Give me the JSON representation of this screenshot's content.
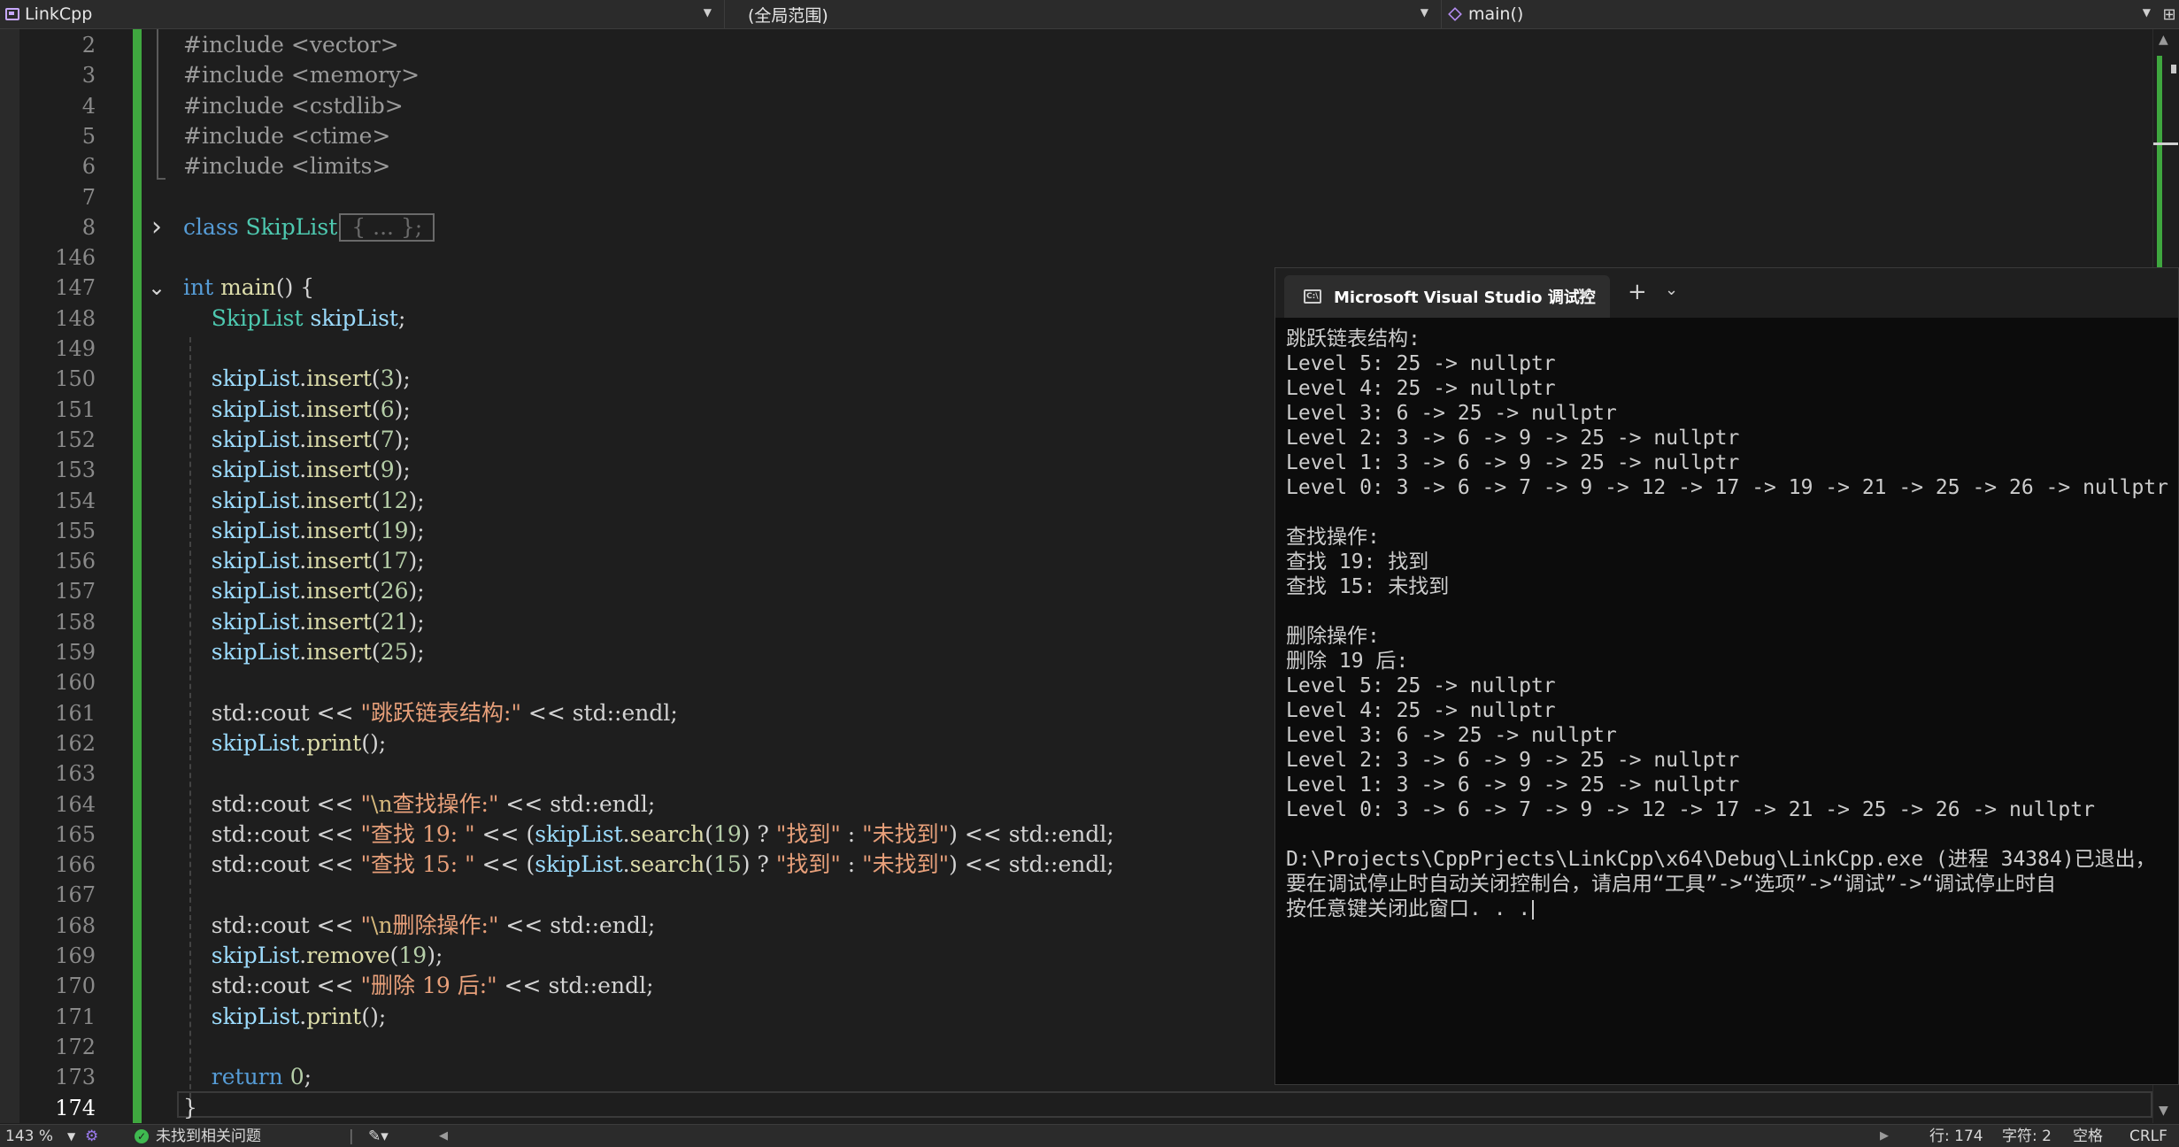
{
  "navbar": {
    "project": "LinkCpp",
    "scope": "(全局范围)",
    "function": "main()",
    "split_icon": "split-icon"
  },
  "editor": {
    "lines": [
      {
        "num": "2",
        "tokens": [
          {
            "t": "#include <vector>",
            "c": "pre"
          }
        ]
      },
      {
        "num": "3",
        "tokens": [
          {
            "t": "#include <memory>",
            "c": "pre"
          }
        ]
      },
      {
        "num": "4",
        "tokens": [
          {
            "t": "#include <cstdlib>",
            "c": "pre"
          }
        ]
      },
      {
        "num": "5",
        "tokens": [
          {
            "t": "#include <ctime>",
            "c": "pre"
          }
        ]
      },
      {
        "num": "6",
        "tokens": [
          {
            "t": "#include <limits>",
            "c": "pre"
          }
        ]
      },
      {
        "num": "7",
        "tokens": []
      },
      {
        "num": "8",
        "fold": "collapsed",
        "tokens": [
          {
            "t": "class ",
            "c": "kw"
          },
          {
            "t": "SkipList",
            "c": "type"
          }
        ],
        "collapsed": "{ ... };"
      },
      {
        "num": "146",
        "tokens": []
      },
      {
        "num": "147",
        "fold": "expanded",
        "tokens": [
          {
            "t": "int ",
            "c": "kw"
          },
          {
            "t": "main",
            "c": "fn"
          },
          {
            "t": "() {",
            "c": "op"
          }
        ]
      },
      {
        "num": "148",
        "tokens": [
          {
            "t": "    ",
            "c": "plain"
          },
          {
            "t": "SkipList ",
            "c": "type"
          },
          {
            "t": "skipList",
            "c": "var"
          },
          {
            "t": ";",
            "c": "op"
          }
        ]
      },
      {
        "num": "149",
        "tokens": []
      },
      {
        "num": "150",
        "tokens": [
          {
            "t": "    ",
            "c": "plain"
          },
          {
            "t": "skipList",
            "c": "var"
          },
          {
            "t": ".",
            "c": "op"
          },
          {
            "t": "insert",
            "c": "fn"
          },
          {
            "t": "(",
            "c": "op"
          },
          {
            "t": "3",
            "c": "num"
          },
          {
            "t": ");",
            "c": "op"
          }
        ]
      },
      {
        "num": "151",
        "tokens": [
          {
            "t": "    ",
            "c": "plain"
          },
          {
            "t": "skipList",
            "c": "var"
          },
          {
            "t": ".",
            "c": "op"
          },
          {
            "t": "insert",
            "c": "fn"
          },
          {
            "t": "(",
            "c": "op"
          },
          {
            "t": "6",
            "c": "num"
          },
          {
            "t": ");",
            "c": "op"
          }
        ]
      },
      {
        "num": "152",
        "tokens": [
          {
            "t": "    ",
            "c": "plain"
          },
          {
            "t": "skipList",
            "c": "var"
          },
          {
            "t": ".",
            "c": "op"
          },
          {
            "t": "insert",
            "c": "fn"
          },
          {
            "t": "(",
            "c": "op"
          },
          {
            "t": "7",
            "c": "num"
          },
          {
            "t": ");",
            "c": "op"
          }
        ]
      },
      {
        "num": "153",
        "tokens": [
          {
            "t": "    ",
            "c": "plain"
          },
          {
            "t": "skipList",
            "c": "var"
          },
          {
            "t": ".",
            "c": "op"
          },
          {
            "t": "insert",
            "c": "fn"
          },
          {
            "t": "(",
            "c": "op"
          },
          {
            "t": "9",
            "c": "num"
          },
          {
            "t": ");",
            "c": "op"
          }
        ]
      },
      {
        "num": "154",
        "tokens": [
          {
            "t": "    ",
            "c": "plain"
          },
          {
            "t": "skipList",
            "c": "var"
          },
          {
            "t": ".",
            "c": "op"
          },
          {
            "t": "insert",
            "c": "fn"
          },
          {
            "t": "(",
            "c": "op"
          },
          {
            "t": "12",
            "c": "num"
          },
          {
            "t": ");",
            "c": "op"
          }
        ]
      },
      {
        "num": "155",
        "tokens": [
          {
            "t": "    ",
            "c": "plain"
          },
          {
            "t": "skipList",
            "c": "var"
          },
          {
            "t": ".",
            "c": "op"
          },
          {
            "t": "insert",
            "c": "fn"
          },
          {
            "t": "(",
            "c": "op"
          },
          {
            "t": "19",
            "c": "num"
          },
          {
            "t": ");",
            "c": "op"
          }
        ]
      },
      {
        "num": "156",
        "tokens": [
          {
            "t": "    ",
            "c": "plain"
          },
          {
            "t": "skipList",
            "c": "var"
          },
          {
            "t": ".",
            "c": "op"
          },
          {
            "t": "insert",
            "c": "fn"
          },
          {
            "t": "(",
            "c": "op"
          },
          {
            "t": "17",
            "c": "num"
          },
          {
            "t": ");",
            "c": "op"
          }
        ]
      },
      {
        "num": "157",
        "tokens": [
          {
            "t": "    ",
            "c": "plain"
          },
          {
            "t": "skipList",
            "c": "var"
          },
          {
            "t": ".",
            "c": "op"
          },
          {
            "t": "insert",
            "c": "fn"
          },
          {
            "t": "(",
            "c": "op"
          },
          {
            "t": "26",
            "c": "num"
          },
          {
            "t": ");",
            "c": "op"
          }
        ]
      },
      {
        "num": "158",
        "tokens": [
          {
            "t": "    ",
            "c": "plain"
          },
          {
            "t": "skipList",
            "c": "var"
          },
          {
            "t": ".",
            "c": "op"
          },
          {
            "t": "insert",
            "c": "fn"
          },
          {
            "t": "(",
            "c": "op"
          },
          {
            "t": "21",
            "c": "num"
          },
          {
            "t": ");",
            "c": "op"
          }
        ]
      },
      {
        "num": "159",
        "tokens": [
          {
            "t": "    ",
            "c": "plain"
          },
          {
            "t": "skipList",
            "c": "var"
          },
          {
            "t": ".",
            "c": "op"
          },
          {
            "t": "insert",
            "c": "fn"
          },
          {
            "t": "(",
            "c": "op"
          },
          {
            "t": "25",
            "c": "num"
          },
          {
            "t": ");",
            "c": "op"
          }
        ]
      },
      {
        "num": "160",
        "tokens": []
      },
      {
        "num": "161",
        "tokens": [
          {
            "t": "    std::cout << ",
            "c": "plain"
          },
          {
            "t": "\"跳跃链表结构:\"",
            "c": "str"
          },
          {
            "t": " << std::endl;",
            "c": "plain"
          }
        ]
      },
      {
        "num": "162",
        "tokens": [
          {
            "t": "    ",
            "c": "plain"
          },
          {
            "t": "skipList",
            "c": "var"
          },
          {
            "t": ".",
            "c": "op"
          },
          {
            "t": "print",
            "c": "fn"
          },
          {
            "t": "();",
            "c": "op"
          }
        ]
      },
      {
        "num": "163",
        "tokens": []
      },
      {
        "num": "164",
        "tokens": [
          {
            "t": "    std::cout << ",
            "c": "plain"
          },
          {
            "t": "\"",
            "c": "str"
          },
          {
            "t": "\\n",
            "c": "esc"
          },
          {
            "t": "查找操作:\"",
            "c": "str"
          },
          {
            "t": " << std::endl;",
            "c": "plain"
          }
        ]
      },
      {
        "num": "165",
        "tokens": [
          {
            "t": "    std::cout << ",
            "c": "plain"
          },
          {
            "t": "\"查找 19: \"",
            "c": "str"
          },
          {
            "t": " << (",
            "c": "plain"
          },
          {
            "t": "skipList",
            "c": "var"
          },
          {
            "t": ".",
            "c": "op"
          },
          {
            "t": "search",
            "c": "fn"
          },
          {
            "t": "(",
            "c": "op"
          },
          {
            "t": "19",
            "c": "num"
          },
          {
            "t": ") ? ",
            "c": "op"
          },
          {
            "t": "\"找到\"",
            "c": "str"
          },
          {
            "t": " : ",
            "c": "op"
          },
          {
            "t": "\"未找到\"",
            "c": "str"
          },
          {
            "t": ") << std::endl;",
            "c": "plain"
          }
        ]
      },
      {
        "num": "166",
        "tokens": [
          {
            "t": "    std::cout << ",
            "c": "plain"
          },
          {
            "t": "\"查找 15: \"",
            "c": "str"
          },
          {
            "t": " << (",
            "c": "plain"
          },
          {
            "t": "skipList",
            "c": "var"
          },
          {
            "t": ".",
            "c": "op"
          },
          {
            "t": "search",
            "c": "fn"
          },
          {
            "t": "(",
            "c": "op"
          },
          {
            "t": "15",
            "c": "num"
          },
          {
            "t": ") ? ",
            "c": "op"
          },
          {
            "t": "\"找到\"",
            "c": "str"
          },
          {
            "t": " : ",
            "c": "op"
          },
          {
            "t": "\"未找到\"",
            "c": "str"
          },
          {
            "t": ") << std::endl;",
            "c": "plain"
          }
        ]
      },
      {
        "num": "167",
        "tokens": []
      },
      {
        "num": "168",
        "tokens": [
          {
            "t": "    std::cout << ",
            "c": "plain"
          },
          {
            "t": "\"",
            "c": "str"
          },
          {
            "t": "\\n",
            "c": "esc"
          },
          {
            "t": "删除操作:\"",
            "c": "str"
          },
          {
            "t": " << std::endl;",
            "c": "plain"
          }
        ]
      },
      {
        "num": "169",
        "tokens": [
          {
            "t": "    ",
            "c": "plain"
          },
          {
            "t": "skipList",
            "c": "var"
          },
          {
            "t": ".",
            "c": "op"
          },
          {
            "t": "remove",
            "c": "fn"
          },
          {
            "t": "(",
            "c": "op"
          },
          {
            "t": "19",
            "c": "num"
          },
          {
            "t": ");",
            "c": "op"
          }
        ]
      },
      {
        "num": "170",
        "tokens": [
          {
            "t": "    std::cout << ",
            "c": "plain"
          },
          {
            "t": "\"删除 19 后:\"",
            "c": "str"
          },
          {
            "t": " << std::endl;",
            "c": "plain"
          }
        ]
      },
      {
        "num": "171",
        "tokens": [
          {
            "t": "    ",
            "c": "plain"
          },
          {
            "t": "skipList",
            "c": "var"
          },
          {
            "t": ".",
            "c": "op"
          },
          {
            "t": "print",
            "c": "fn"
          },
          {
            "t": "();",
            "c": "op"
          }
        ]
      },
      {
        "num": "172",
        "tokens": []
      },
      {
        "num": "173",
        "tokens": [
          {
            "t": "    ",
            "c": "plain"
          },
          {
            "t": "return ",
            "c": "kw"
          },
          {
            "t": "0",
            "c": "num"
          },
          {
            "t": ";",
            "c": "op"
          }
        ]
      },
      {
        "num": "174",
        "current": true,
        "tokens": [
          {
            "t": "}",
            "c": "plain"
          }
        ]
      }
    ]
  },
  "terminal": {
    "tab_title": "Microsoft Visual Studio 调试控",
    "tab_icon": "console-icon",
    "new_tab_label": "+",
    "dropdown_icon": "chevron-down-icon",
    "lines": [
      "跳跃链表结构:",
      "Level 5: 25 -> nullptr",
      "Level 4: 25 -> nullptr",
      "Level 3: 6 -> 25 -> nullptr",
      "Level 2: 3 -> 6 -> 9 -> 25 -> nullptr",
      "Level 1: 3 -> 6 -> 9 -> 25 -> nullptr",
      "Level 0: 3 -> 6 -> 7 -> 9 -> 12 -> 17 -> 19 -> 21 -> 25 -> 26 -> nullptr",
      "",
      "查找操作:",
      "查找 19: 找到",
      "查找 15: 未找到",
      "",
      "删除操作:",
      "删除 19 后:",
      "Level 5: 25 -> nullptr",
      "Level 4: 25 -> nullptr",
      "Level 3: 6 -> 25 -> nullptr",
      "Level 2: 3 -> 6 -> 9 -> 25 -> nullptr",
      "Level 1: 3 -> 6 -> 9 -> 25 -> nullptr",
      "Level 0: 3 -> 6 -> 7 -> 9 -> 12 -> 17 -> 21 -> 25 -> 26 -> nullptr",
      "",
      "D:\\Projects\\CppPrjects\\LinkCpp\\x64\\Debug\\LinkCpp.exe (进程 34384)已退出，",
      "要在调试停止时自动关闭控制台，请启用“工具”->“选项”->“调试”->“调试停止时自",
      "按任意键关闭此窗口. . ."
    ]
  },
  "statusbar": {
    "zoom": "143 %",
    "issues": "未找到相关问题",
    "line": "行: 174",
    "char": "字符: 2",
    "spaces": "空格",
    "eol": "CRLF"
  },
  "colors": {
    "change_bar": "#3fa73f",
    "keyword": "#569cd6",
    "type": "#4ec9b0",
    "function": "#dcdcaa",
    "variable": "#9cdcfe",
    "string": "#e8a07a",
    "number": "#b5cea8"
  }
}
